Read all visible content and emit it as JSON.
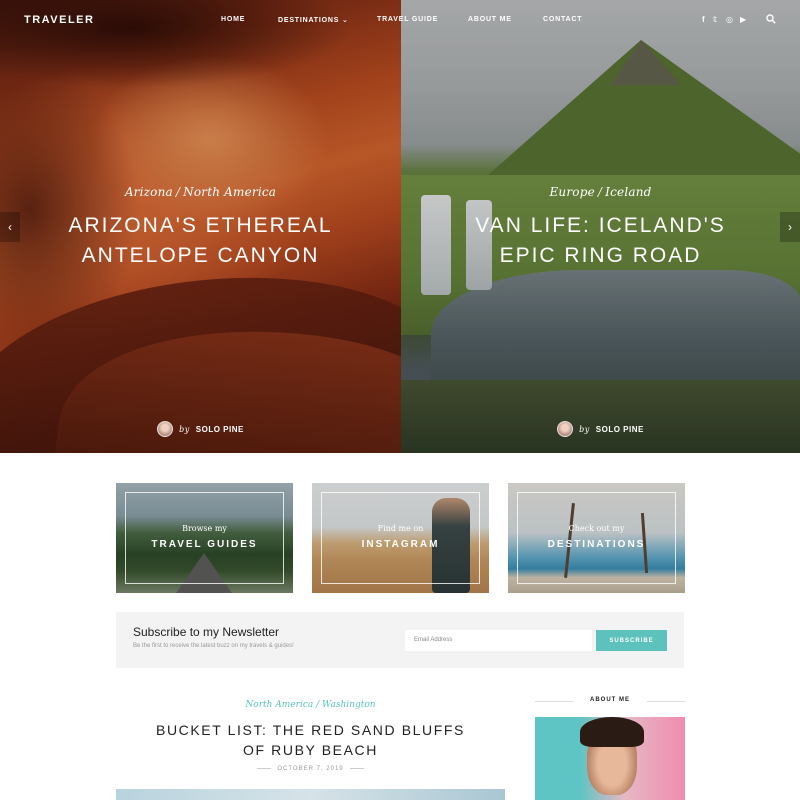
{
  "header": {
    "logo": "TRAVELER",
    "nav": [
      "HOME",
      "DESTINATIONS",
      "TRAVEL GUIDE",
      "ABOUT ME",
      "CONTACT"
    ],
    "destinations_caret": "⌄",
    "social_icons": [
      "facebook-icon",
      "twitter-icon",
      "instagram-icon",
      "youtube-icon"
    ],
    "social_glyphs": [
      "f",
      "𝕥",
      "◎",
      "▶"
    ]
  },
  "slider": {
    "prev_glyph": "‹",
    "next_glyph": "›",
    "slides": [
      {
        "category_1": "Arizona",
        "category_2": "North America",
        "separator": "/",
        "title": "ARIZONA'S ETHEREAL ANTELOPE CANYON",
        "by": "by",
        "author": "SOLO PINE"
      },
      {
        "category_1": "Europe",
        "category_2": "Iceland",
        "separator": "/",
        "title": "VAN LIFE: ICELAND'S EPIC RING ROAD",
        "by": "by",
        "author": "SOLO PINE"
      }
    ]
  },
  "promos": [
    {
      "small": "Browse my",
      "big": "TRAVEL GUIDES"
    },
    {
      "small": "Find me on",
      "big": "INSTAGRAM"
    },
    {
      "small": "Check out my",
      "big": "DESTINATIONS"
    }
  ],
  "newsletter": {
    "title": "Subscribe to my Newsletter",
    "description": "Be the first to receive the latest buzz on my travels & guides!",
    "placeholder": "Email Address",
    "button": "SUBSCRIBE"
  },
  "post": {
    "category_1": "North America",
    "separator": "/",
    "category_2": "Washington",
    "title": "BUCKET LIST: THE RED SAND BLUFFS OF RUBY BEACH",
    "date": "OCTOBER 7, 2019"
  },
  "sidebar": {
    "about_heading": "ABOUT ME"
  },
  "colors": {
    "accent": "#5cc2bb",
    "newsletter_bg": "#f3f3f3"
  }
}
